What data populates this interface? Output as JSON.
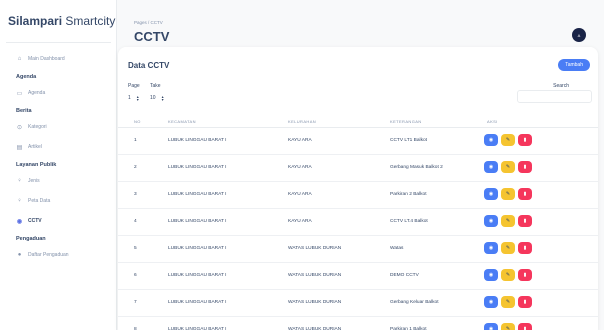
{
  "app": {
    "brand_bold": "Silampari",
    "brand_rest": " Smartcity"
  },
  "header": {
    "breadcrumb": "Pages / CCTV",
    "title": "CCTV",
    "avatar_initial": "A"
  },
  "sidebar": {
    "items": [
      {
        "type": "item",
        "label": "Main Dashboard",
        "icon": "home-icon",
        "active": false
      },
      {
        "type": "section",
        "label": "Agenda"
      },
      {
        "type": "item",
        "label": "Agenda",
        "icon": "calendar-icon",
        "active": false
      },
      {
        "type": "section",
        "label": "Berita"
      },
      {
        "type": "item",
        "label": "Kategori",
        "icon": "category-icon",
        "active": false
      },
      {
        "type": "item",
        "label": "Artikel",
        "icon": "article-icon",
        "active": false
      },
      {
        "type": "section",
        "label": "Layanan Publik"
      },
      {
        "type": "item",
        "label": "Jenis",
        "icon": "pin-icon",
        "active": false
      },
      {
        "type": "item",
        "label": "Peta Data",
        "icon": "map-pin-icon",
        "active": false
      },
      {
        "type": "item",
        "label": "CCTV",
        "icon": "camera-icon",
        "active": true
      },
      {
        "type": "section",
        "label": "Pengaduan"
      },
      {
        "type": "item",
        "label": "Daftar Pengaduan",
        "icon": "info-icon",
        "active": false
      }
    ]
  },
  "card": {
    "title": "Data CCTV",
    "add_label": "Tambah",
    "page_label": "Page",
    "page_value": "1",
    "take_label": "Take",
    "take_value": "10",
    "search_label": "Search",
    "search_value": ""
  },
  "table": {
    "columns": [
      "NO",
      "KECAMATAN",
      "KELURAHAN",
      "KETERANGAN",
      "AKSI"
    ],
    "rows": [
      [
        "1",
        "LUBUK LINGGAU BARAT I",
        "KAYU ARA",
        "CCTV LT1 Balkot"
      ],
      [
        "2",
        "LUBUK LINGGAU BARAT I",
        "KAYU ARA",
        "Gerbang Masuk Balkot 2"
      ],
      [
        "3",
        "LUBUK LINGGAU BARAT I",
        "KAYU ARA",
        "Parkiran 2 Balkot"
      ],
      [
        "4",
        "LUBUK LINGGAU BARAT I",
        "KAYU ARA",
        "CCTV LT.4 Balkot"
      ],
      [
        "5",
        "LUBUK LINGGAU BARAT I",
        "WATAS LUBUK DURIAN",
        "Watas"
      ],
      [
        "6",
        "LUBUK LINGGAU BARAT I",
        "WATAS LUBUK DURIAN",
        "DEMO CCTV"
      ],
      [
        "7",
        "LUBUK LINGGAU BARAT I",
        "WATAS LUBUK DURIAN",
        "Gerbang Keluar Balkot"
      ],
      [
        "8",
        "LUBUK LINGGAU BARAT I",
        "WATAS LUBUK DURIAN",
        "Parkiran 1 Balkot"
      ]
    ]
  },
  "colors": {
    "view": "#4a7df5",
    "edit": "#f5c430",
    "delete": "#f5365c",
    "primary": "#4a7df5"
  }
}
